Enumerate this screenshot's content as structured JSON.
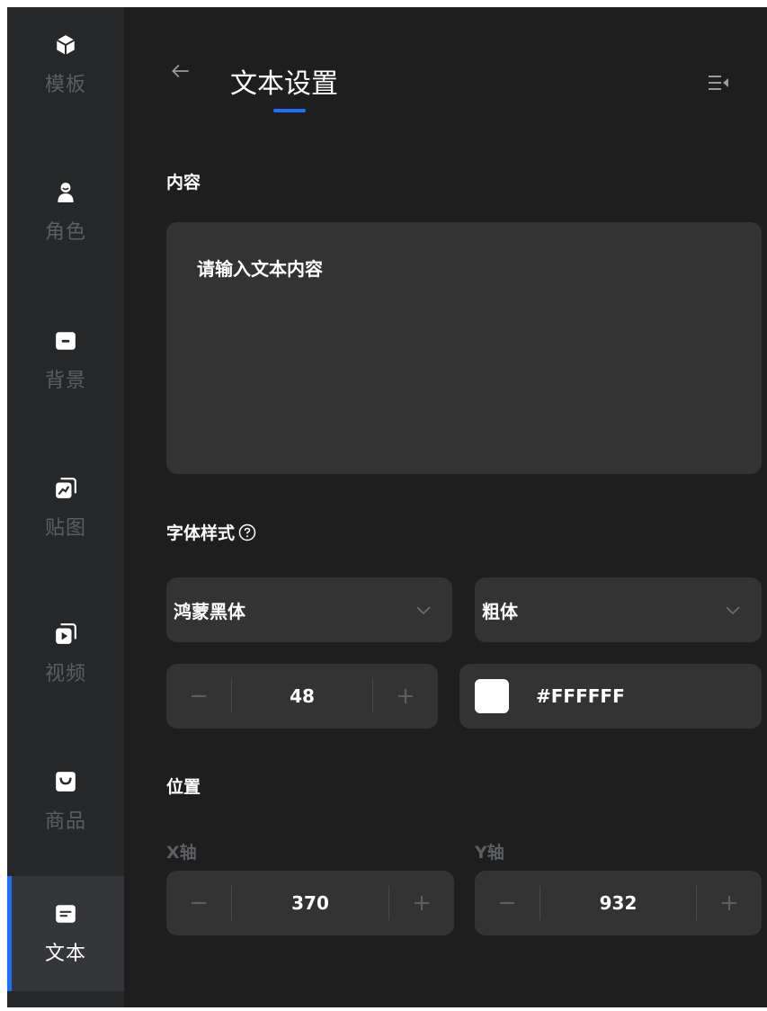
{
  "sidebar": {
    "items": [
      {
        "label": "模板",
        "icon": "cube-icon"
      },
      {
        "label": "角色",
        "icon": "person-icon"
      },
      {
        "label": "背景",
        "icon": "background-icon"
      },
      {
        "label": "贴图",
        "icon": "sticker-icon"
      },
      {
        "label": "视频",
        "icon": "video-icon"
      },
      {
        "label": "商品",
        "icon": "shopping-bag-icon"
      },
      {
        "label": "文本",
        "icon": "text-icon",
        "active": true
      }
    ],
    "active_color": "#1f6fff"
  },
  "header": {
    "title": "文本设置"
  },
  "content": {
    "label": "内容",
    "placeholder": "请输入文本内容"
  },
  "font_style": {
    "label": "字体样式",
    "font_family": "鸿蒙黑体",
    "font_weight": "粗体",
    "size": "48",
    "color_hex": "#FFFFFF",
    "minus": "−",
    "plus": "+"
  },
  "position": {
    "label": "位置",
    "x_label": "X轴",
    "x_value": "370",
    "y_label": "Y轴",
    "y_value": "932",
    "minus": "−",
    "plus": "+"
  }
}
